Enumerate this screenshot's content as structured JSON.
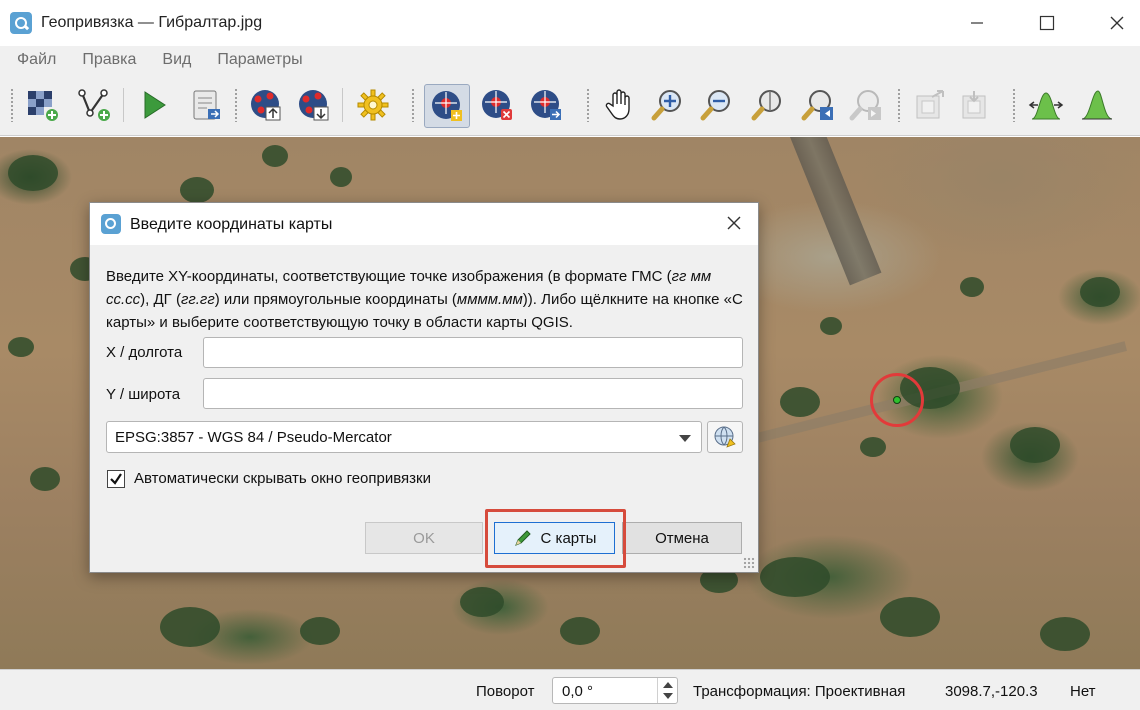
{
  "window": {
    "title": "Геопривязка — Гибралтар.jpg",
    "minimize_icon": "minimize-icon",
    "maximize_icon": "maximize-icon",
    "close_icon": "close-icon"
  },
  "menu": {
    "items": [
      "Файл",
      "Правка",
      "Вид",
      "Параметры"
    ]
  },
  "toolbar": {
    "buttons": [
      {
        "name": "open-raster-button",
        "icon": "open-raster-icon"
      },
      {
        "name": "open-gcp-points-button",
        "icon": "add-vector-icon"
      },
      {
        "name": "start-georeferencing-button",
        "icon": "play-icon"
      },
      {
        "name": "generate-gdal-script-button",
        "icon": "script-export-icon"
      },
      {
        "name": "load-gcp-points-button",
        "icon": "load-gcp-icon"
      },
      {
        "name": "save-gcp-points-button",
        "icon": "save-gcp-icon"
      },
      {
        "name": "transformation-settings-button",
        "icon": "gear-icon"
      },
      {
        "name": "add-point-button",
        "icon": "add-point-icon",
        "active": true
      },
      {
        "name": "delete-point-button",
        "icon": "delete-point-icon"
      },
      {
        "name": "move-gcp-point-button",
        "icon": "move-point-icon"
      },
      {
        "name": "pan-button",
        "icon": "hand-pan-icon"
      },
      {
        "name": "zoom-in-button",
        "icon": "zoom-in-icon"
      },
      {
        "name": "zoom-out-button",
        "icon": "zoom-out-icon"
      },
      {
        "name": "zoom-to-layer-button",
        "icon": "zoom-layer-icon"
      },
      {
        "name": "zoom-last-button",
        "icon": "zoom-last-icon"
      },
      {
        "name": "zoom-next-button",
        "icon": "zoom-next-icon"
      },
      {
        "name": "link-georeferencer-button",
        "icon": "link-georef-icon"
      },
      {
        "name": "link-qgis-button",
        "icon": "link-qgis-icon"
      },
      {
        "name": "full-histogram-stretch-button",
        "icon": "histogram-full-icon"
      },
      {
        "name": "local-histogram-stretch-button",
        "icon": "histogram-local-icon"
      }
    ]
  },
  "dialog": {
    "title": "Введите координаты карты",
    "description_parts": [
      "Введите XY-координаты, соответствующие точке изображения (в формате ГМС (",
      "гг мм сс.сс",
      "), ДГ (",
      "гг.гг",
      ") или прямоугольные координаты (",
      "мммм.мм",
      ")). Либо щёлкните на кнопке «С карты» и выберите соответствующую точку в области карты QGIS."
    ],
    "x_label": "X / долгота",
    "x_value": "",
    "y_label": "Y / широта",
    "y_value": "",
    "crs_value": "EPSG:3857 - WGS 84 / Pseudo-Mercator",
    "checkbox_label": "Автоматически скрывать окно геопривязки",
    "checkbox_checked": true,
    "ok_label": "OK",
    "from_map_label": "С карты",
    "cancel_label": "Отмена"
  },
  "status": {
    "rotation_label": "Поворот",
    "rotation_value": "0,0 °",
    "transform_label": "Трансформация: Проективная",
    "coords": "3098.7,-120.3",
    "crs_none": "Нет"
  },
  "colors": {
    "accent": "#1e6fd2",
    "highlight": "#d64b3c",
    "gcp_ring": "#e23a3a",
    "gcp_dot": "#2ec12e"
  }
}
